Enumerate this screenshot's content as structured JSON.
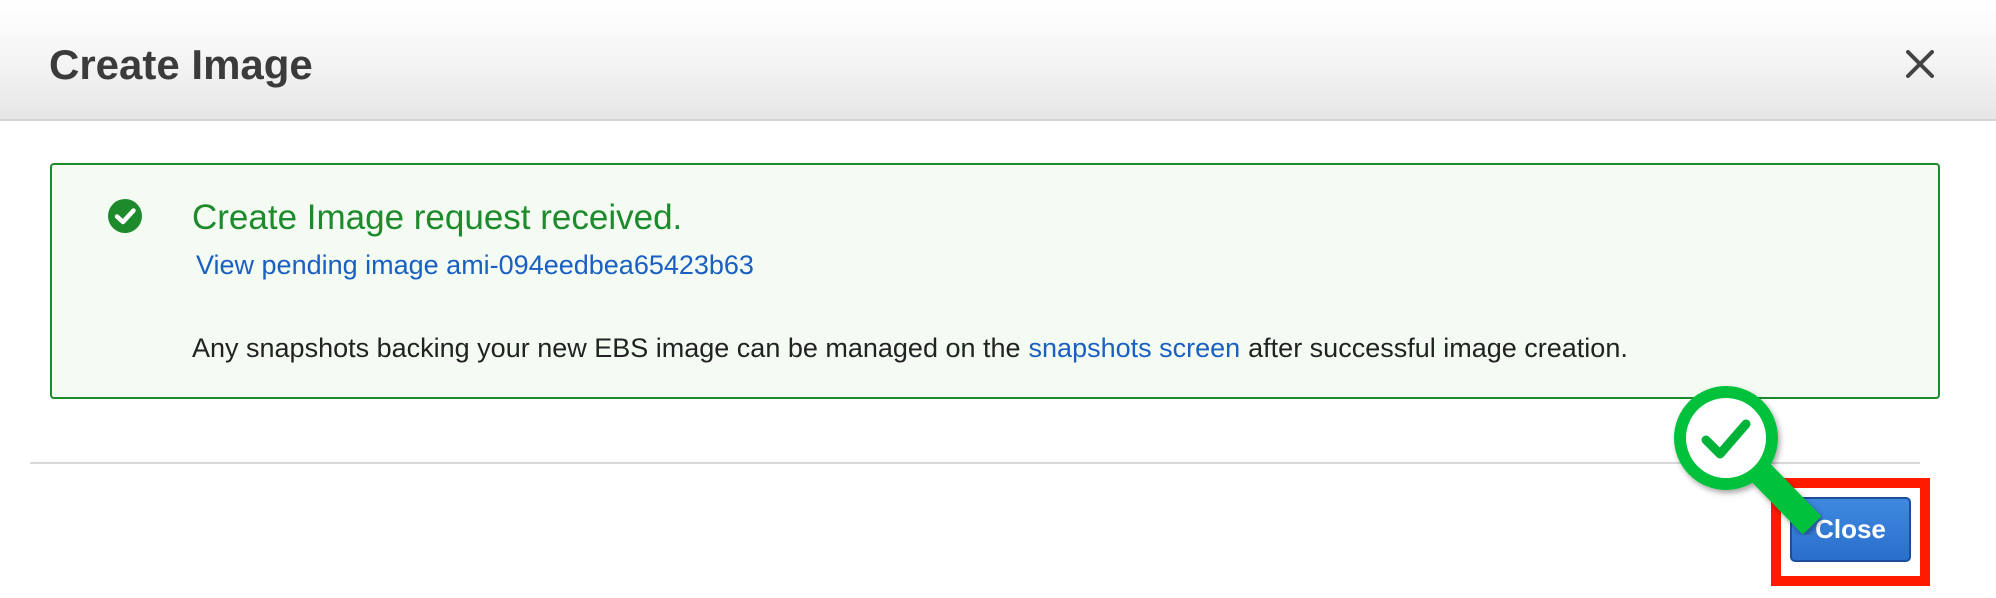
{
  "dialog": {
    "title": "Create Image"
  },
  "alert": {
    "title": "Create Image request received.",
    "pending_link": "View pending image ami-094eedbea65423b63",
    "text_before": "Any snapshots backing your new EBS image can be managed on the",
    "snapshots_link": "snapshots screen",
    "text_after": "after successful image creation."
  },
  "footer": {
    "close_label": "Close"
  },
  "colors": {
    "success_green": "#1d8a2c",
    "link_blue": "#1a5fc2",
    "button_blue": "#2a6fcb",
    "highlight_red": "#ff1a00",
    "magnifier_green": "#00c13a"
  },
  "icons": {
    "dialog_close": "close-x-icon",
    "alert_status": "check-circle-icon",
    "annotation": "magnifier-check-icon"
  }
}
